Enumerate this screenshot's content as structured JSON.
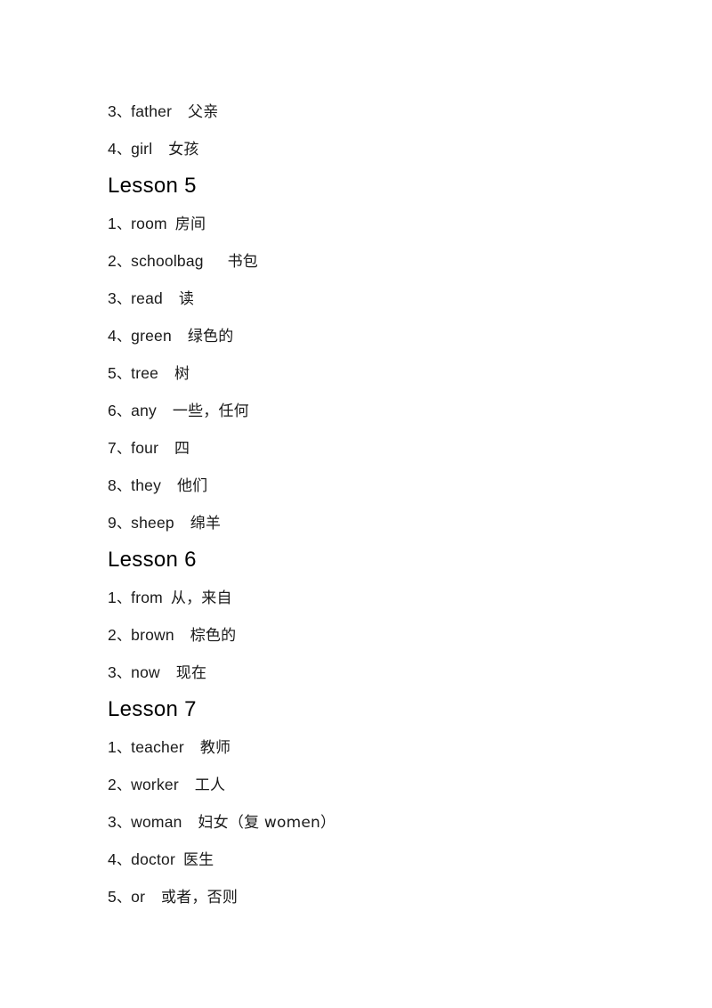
{
  "document": {
    "sections": [
      {
        "heading": null,
        "entries": [
          {
            "number": "3",
            "marker": "、",
            "term": "father",
            "space": "  ",
            "gloss": "父亲"
          },
          {
            "number": "4",
            "marker": "、",
            "term": "girl",
            "space": "  ",
            "gloss": "女孩"
          }
        ]
      },
      {
        "heading": "Lesson 5",
        "entries": [
          {
            "number": "1",
            "marker": "、",
            "term": "room",
            "space": " ",
            "gloss": "房间"
          },
          {
            "number": "2",
            "marker": "、",
            "term": "schoolbag",
            "space": "   ",
            "gloss": "书包"
          },
          {
            "number": "3",
            "marker": "、",
            "term": "read",
            "space": "  ",
            "gloss": "读"
          },
          {
            "number": "4",
            "marker": "、",
            "term": "green",
            "space": "  ",
            "gloss": "绿色的"
          },
          {
            "number": "5",
            "marker": "、",
            "term": "tree",
            "space": "  ",
            "gloss": "树"
          },
          {
            "number": "6",
            "marker": "、",
            "term": "any",
            "space": "  ",
            "gloss": "一些，任何"
          },
          {
            "number": "7",
            "marker": "、",
            "term": "four",
            "space": "  ",
            "gloss": "四"
          },
          {
            "number": "8",
            "marker": "、",
            "term": "they",
            "space": "  ",
            "gloss": "他们"
          },
          {
            "number": "9",
            "marker": "、",
            "term": "sheep",
            "space": "  ",
            "gloss": "绵羊"
          }
        ]
      },
      {
        "heading": "Lesson 6",
        "entries": [
          {
            "number": "1",
            "marker": "、",
            "term": "from",
            "space": " ",
            "gloss": "从，来自"
          },
          {
            "number": "2",
            "marker": "、",
            "term": "brown",
            "space": "  ",
            "gloss": "棕色的"
          },
          {
            "number": "3",
            "marker": "、",
            "term": "now",
            "space": "  ",
            "gloss": "现在"
          }
        ]
      },
      {
        "heading": "Lesson 7",
        "entries": [
          {
            "number": "1",
            "marker": "、",
            "term": "teacher",
            "space": "  ",
            "gloss": "教师"
          },
          {
            "number": "2",
            "marker": "、",
            "term": "worker",
            "space": "  ",
            "gloss": "工人"
          },
          {
            "number": "3",
            "marker": "、",
            "term": "woman",
            "space": "  ",
            "gloss": "妇女（复 women）"
          },
          {
            "number": "4",
            "marker": "、",
            "term": "doctor",
            "space": " ",
            "gloss": "医生"
          },
          {
            "number": "5",
            "marker": "、",
            "term": "or",
            "space": "  ",
            "gloss": "或者，否则"
          }
        ]
      }
    ]
  },
  "style": {
    "page_background": "#ffffff",
    "text_color": "#1a1a1a",
    "heading_color": "#000000"
  }
}
